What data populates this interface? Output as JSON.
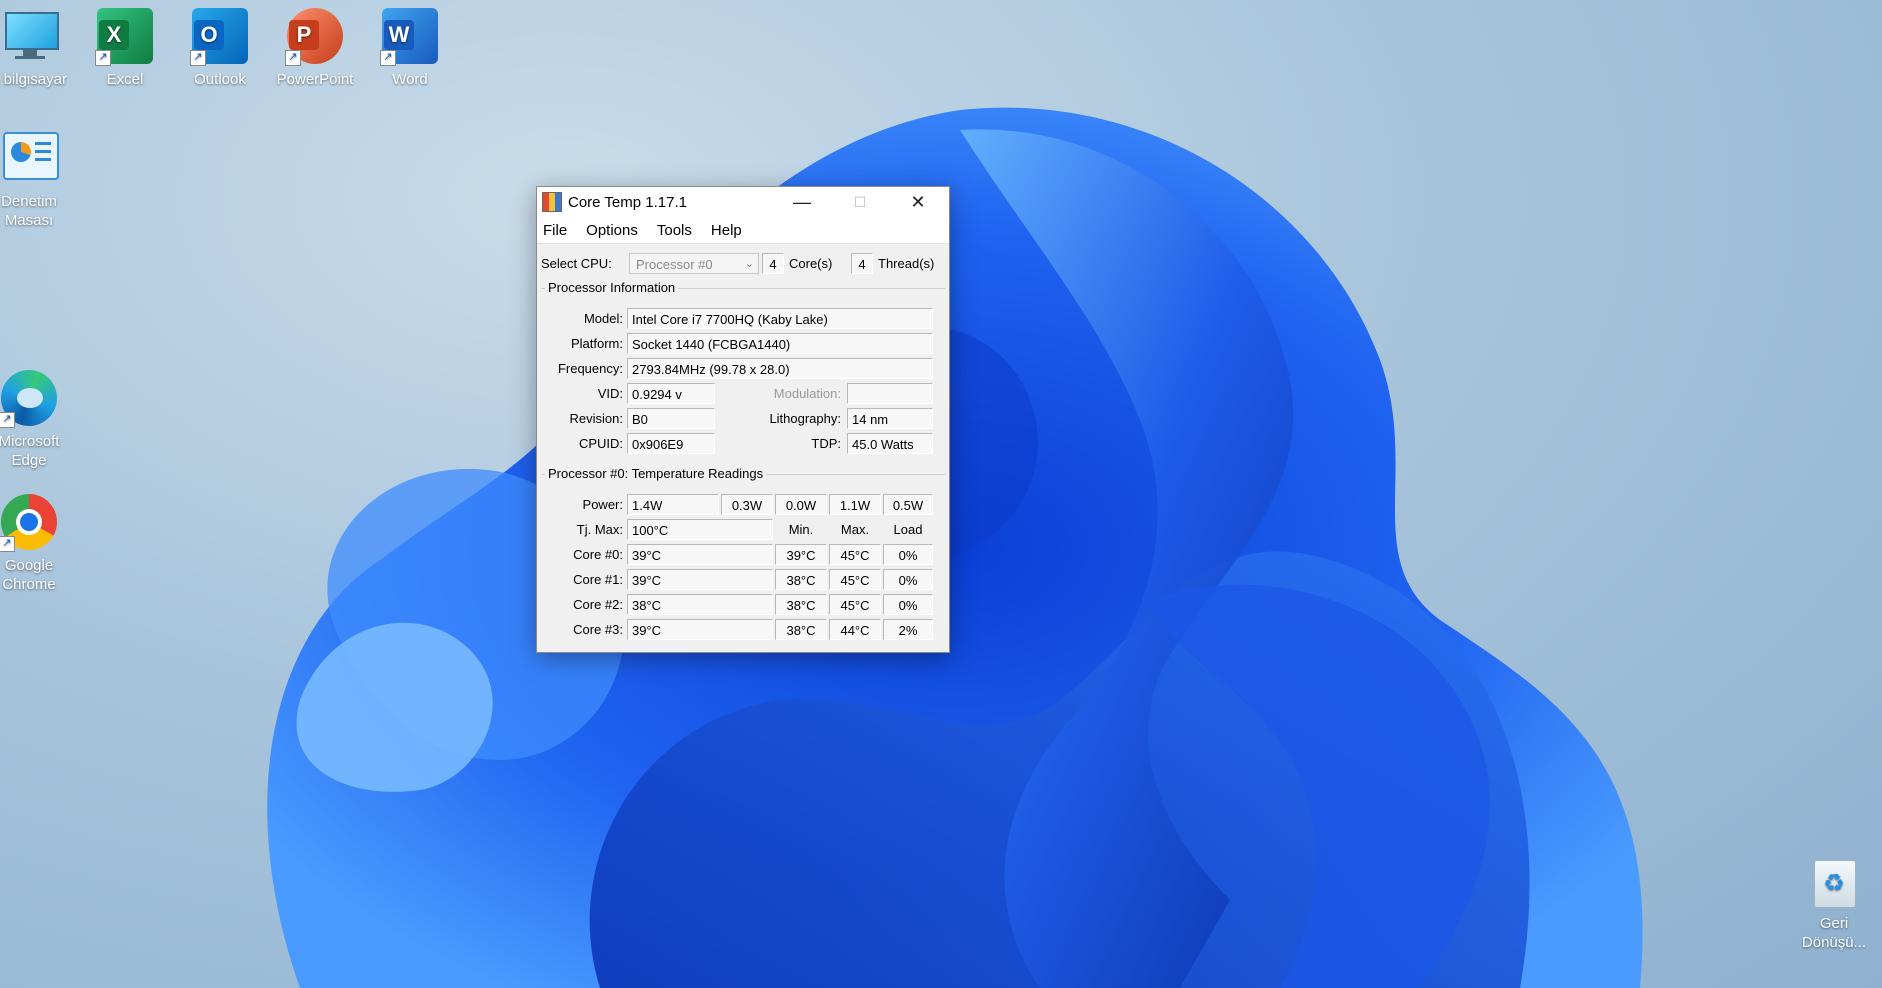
{
  "desktop": {
    "icons": [
      {
        "label": "u bilgisayar"
      },
      {
        "label": "Excel"
      },
      {
        "label": "Outlook"
      },
      {
        "label": "PowerPoint"
      },
      {
        "label": "Word"
      },
      {
        "label": "Denetim Masası"
      },
      {
        "label": "Microsoft Edge"
      },
      {
        "label": "Google Chrome"
      },
      {
        "label": "Geri Dönüşü..."
      }
    ]
  },
  "window": {
    "title": "Core Temp 1.17.1",
    "menu": [
      "File",
      "Options",
      "Tools",
      "Help"
    ],
    "select_cpu_label": "Select CPU:",
    "processor_select": "Processor #0",
    "cores_value": "4",
    "cores_label": "Core(s)",
    "threads_value": "4",
    "threads_label": "Thread(s)",
    "processor_info": {
      "title": "Processor Information",
      "model_label": "Model:",
      "model": "Intel Core i7 7700HQ (Kaby Lake)",
      "platform_label": "Platform:",
      "platform": "Socket 1440 (FCBGA1440)",
      "frequency_label": "Frequency:",
      "frequency": "2793.84MHz (99.78 x 28.0)",
      "vid_label": "VID:",
      "vid": "0.9294 v",
      "modulation_label": "Modulation:",
      "modulation": "",
      "revision_label": "Revision:",
      "revision": "B0",
      "lithography_label": "Lithography:",
      "lithography": "14 nm",
      "cpuid_label": "CPUID:",
      "cpuid": "0x906E9",
      "tdp_label": "TDP:",
      "tdp": "45.0 Watts"
    },
    "temps": {
      "title": "Processor #0: Temperature Readings",
      "power_label": "Power:",
      "power": [
        "1.4W",
        "0.3W",
        "0.0W",
        "1.1W",
        "0.5W"
      ],
      "tjmax_label": "Tj. Max:",
      "tjmax": "100°C",
      "min_header": "Min.",
      "max_header": "Max.",
      "load_header": "Load",
      "cores": [
        {
          "label": "Core #0:",
          "temp": "39°C",
          "min": "39°C",
          "max": "45°C",
          "load": "0%"
        },
        {
          "label": "Core #1:",
          "temp": "39°C",
          "min": "38°C",
          "max": "45°C",
          "load": "0%"
        },
        {
          "label": "Core #2:",
          "temp": "38°C",
          "min": "38°C",
          "max": "45°C",
          "load": "0%"
        },
        {
          "label": "Core #3:",
          "temp": "39°C",
          "min": "38°C",
          "max": "44°C",
          "load": "2%"
        }
      ]
    }
  }
}
